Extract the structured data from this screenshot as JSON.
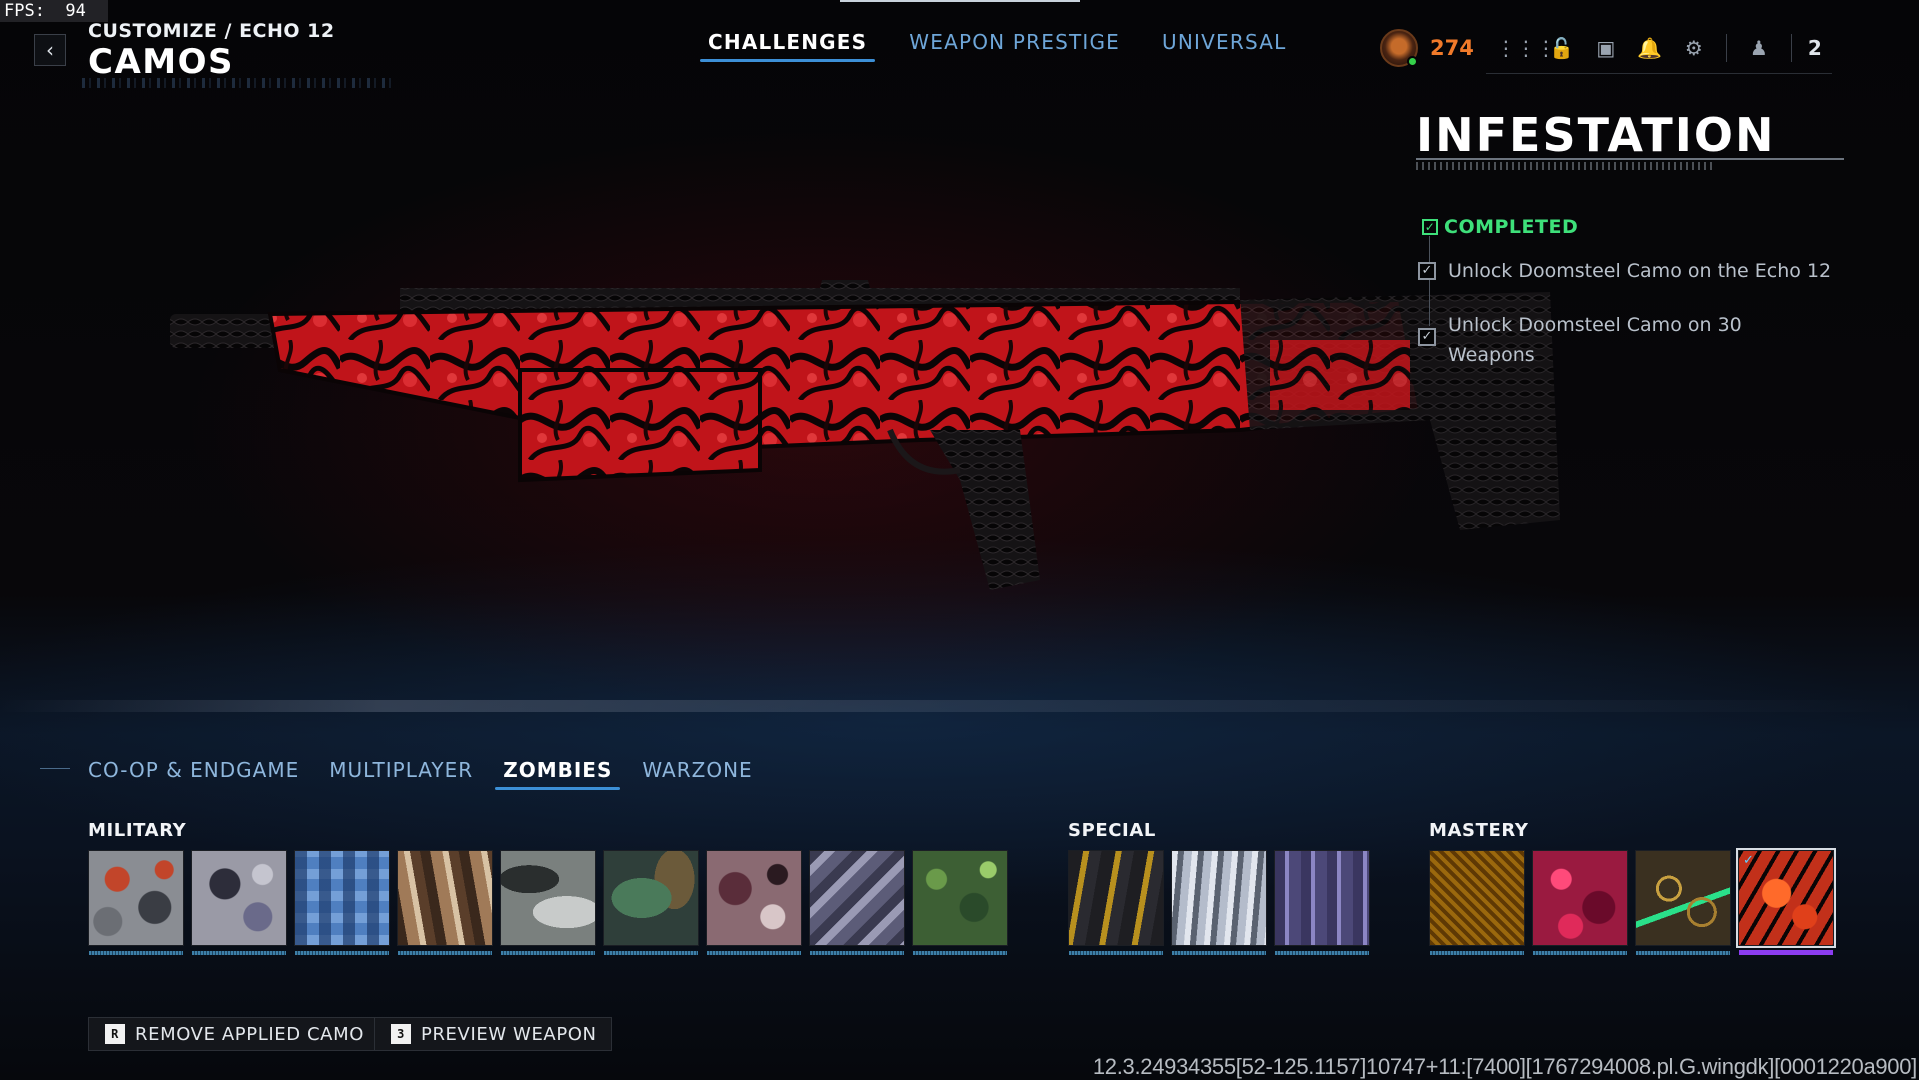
{
  "fps": "FPS:  94",
  "header": {
    "breadcrumb": "CUSTOMIZE / ECHO 12",
    "title": "CAMOS"
  },
  "top_tabs": [
    {
      "label": "CHALLENGES",
      "active": true
    },
    {
      "label": "WEAPON PRESTIGE",
      "active": false
    },
    {
      "label": "UNIVERSAL",
      "active": false
    }
  ],
  "hud": {
    "currency": "274",
    "count": "2",
    "accent": "#f07a2a"
  },
  "camo_detail": {
    "name": "INFESTATION",
    "status": "COMPLETED",
    "challenges": [
      "Unlock Doomsteel Camo on the Echo 12",
      "Unlock Doomsteel Camo on 30 Weapons"
    ]
  },
  "mode_tabs": [
    {
      "label": "CO-OP & ENDGAME",
      "active": false
    },
    {
      "label": "MULTIPLAYER",
      "active": false
    },
    {
      "label": "ZOMBIES",
      "active": true
    },
    {
      "label": "WARZONE",
      "active": false
    }
  ],
  "groups": {
    "military": {
      "label": "MILITARY"
    },
    "special": {
      "label": "SPECIAL"
    },
    "mastery": {
      "label": "MASTERY"
    }
  },
  "actions": {
    "remove": {
      "key": "R",
      "label": "REMOVE APPLIED CAMO"
    },
    "preview": {
      "key": "3",
      "label": "PREVIEW WEAPON"
    }
  },
  "build_string": "12.3.24934355[52-125.1157]10747+11:[7400][1767294008.pl.G.wingdk][0001220a900]",
  "colors": {
    "tab_active_underline": "#3c8fd6",
    "completed_green": "#3ee07a",
    "selected_bar": "#8b3cf0"
  }
}
